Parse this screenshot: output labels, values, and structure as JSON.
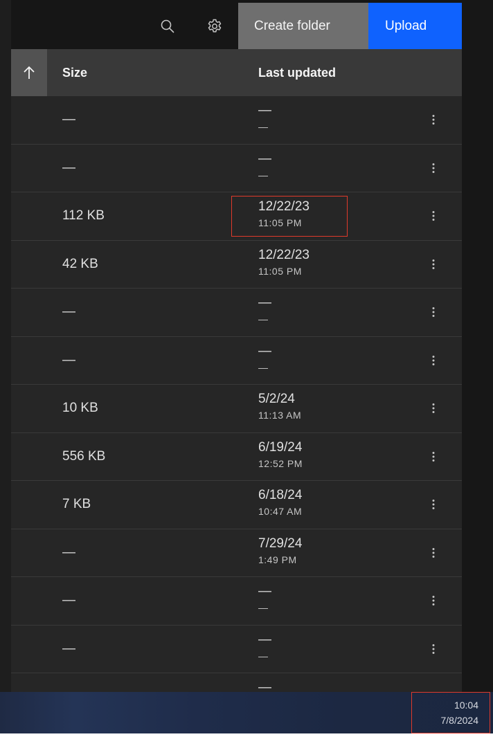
{
  "toolbar": {
    "search_icon": "search-icon",
    "settings_icon": "gear-icon",
    "create_folder_label": "Create folder",
    "upload_label": "Upload"
  },
  "table": {
    "sort_icon": "arrow-up-icon",
    "columns": {
      "size": "Size",
      "last_updated": "Last updated"
    },
    "rows": [
      {
        "size": "—",
        "date": "—",
        "time": "—"
      },
      {
        "size": "—",
        "date": "—",
        "time": "—"
      },
      {
        "size": "112 KB",
        "date": "12/22/23",
        "time": "11:05 PM"
      },
      {
        "size": "42 KB",
        "date": "12/22/23",
        "time": "11:05 PM"
      },
      {
        "size": "—",
        "date": "—",
        "time": "—"
      },
      {
        "size": "—",
        "date": "—",
        "time": "—"
      },
      {
        "size": "10 KB",
        "date": "5/2/24",
        "time": "11:13 AM"
      },
      {
        "size": "556 KB",
        "date": "6/19/24",
        "time": "12:52 PM"
      },
      {
        "size": "7 KB",
        "date": "6/18/24",
        "time": "10:47 AM"
      },
      {
        "size": "—",
        "date": "7/29/24",
        "time": "1:49 PM"
      },
      {
        "size": "—",
        "date": "—",
        "time": "—"
      },
      {
        "size": "—",
        "date": "—",
        "time": "—"
      },
      {
        "size": "",
        "date": "—",
        "time": ""
      }
    ],
    "menu_icon": "overflow-menu-vertical-icon"
  },
  "taskbar": {
    "clock_time": "10:04",
    "clock_date": "7/8/2024"
  },
  "colors": {
    "primary_button": "#0f62fe",
    "secondary_button": "#6f6f6f",
    "annotation_box": "#e03a2b"
  }
}
